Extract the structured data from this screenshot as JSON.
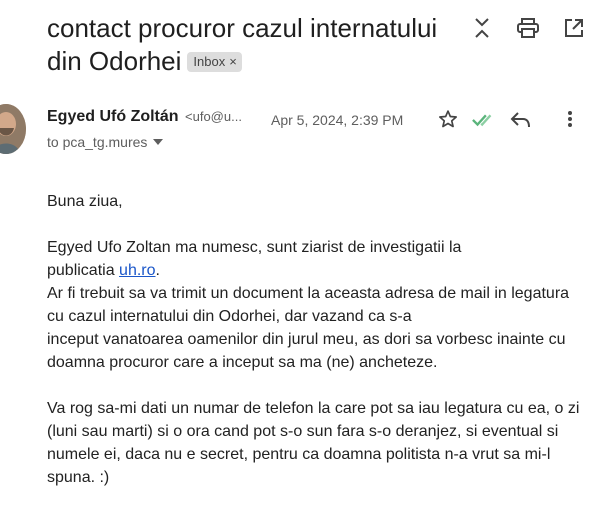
{
  "email": {
    "subject": "contact procuror cazul internatului din Odorhei",
    "label": "Inbox",
    "label_remove": "×",
    "sender_name": "Egyed Ufó Zoltán",
    "sender_email": "<ufo@u...",
    "date": "Apr 5, 2024, 2:39 PM",
    "to_line": "to pca_tg.mures",
    "body": {
      "greeting": "Buna ziua,",
      "p1_line1": "Egyed Ufo Zoltan ma numesc, sunt ziarist de investigatii la",
      "p1_line2_prefix": "publicatia ",
      "p1_link": "uh.ro",
      "p1_line2_suffix": ".",
      "p1_line3": "Ar fi trebuit sa va trimit un document la aceasta adresa de mail in legatura cu cazul internatului din Odorhei, dar vazand ca s-a",
      "p1_line4": "inceput vanatoarea oamenilor din jurul meu, as dori sa vorbesc inainte cu doamna procuror care a inceput sa ma (ne) ancheteze.",
      "p2": "Va rog sa-mi dati un numar de telefon la care pot sa iau legatura cu ea, o zi (luni sau marti) si o ora cand pot s-o sun fara s-o deranjez, si eventual si numele ei, daca nu e secret, pentru ca doamna politista n-a vrut sa mi-l spuna. :)"
    }
  },
  "icons": {
    "collapse": "collapse-icon",
    "print": "print-icon",
    "open_new_window": "open-in-new-window-icon",
    "star": "star-icon",
    "read_receipt": "double-check-icon",
    "reply": "reply-icon",
    "more": "more-vert-icon",
    "caret": "chevron-down-icon"
  },
  "colors": {
    "check_green": "#5ab47b",
    "link_blue": "#1a56c9",
    "label_bg": "#dddddd"
  }
}
